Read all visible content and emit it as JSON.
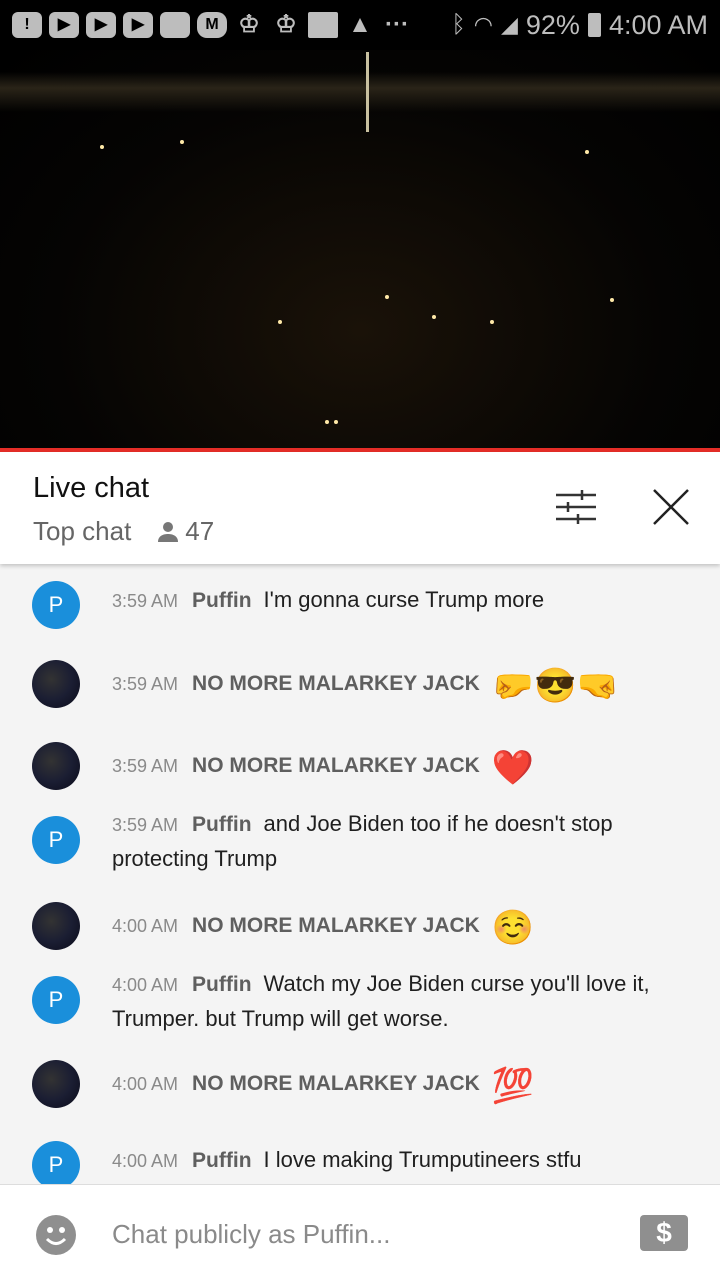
{
  "status_bar": {
    "battery": "92%",
    "time": "4:00 AM"
  },
  "video": {
    "progress_color": "#e52d27"
  },
  "chat_header": {
    "title": "Live chat",
    "mode": "Top chat",
    "viewer_count": "47"
  },
  "messages": [
    {
      "time": "3:59 AM",
      "author": "Puffin",
      "avatar_letter": "P",
      "text": "I'm gonna curse Trump more"
    },
    {
      "time": "3:59 AM",
      "author": "NO MORE MALARKEY JACK",
      "text": "🤛😎🤜"
    },
    {
      "time": "3:59 AM",
      "author": "NO MORE MALARKEY JACK",
      "text": "❤️"
    },
    {
      "time": "3:59 AM",
      "author": "Puffin",
      "avatar_letter": "P",
      "text": "and Joe Biden too if he doesn't stop protecting Trump"
    },
    {
      "time": "4:00 AM",
      "author": "NO MORE MALARKEY JACK",
      "text": "☺️"
    },
    {
      "time": "4:00 AM",
      "author": "Puffin",
      "avatar_letter": "P",
      "text": "Watch my Joe Biden curse you'll love it, Trumper. but Trump will get worse."
    },
    {
      "time": "4:00 AM",
      "author": "NO MORE MALARKEY JACK",
      "text": "💯"
    },
    {
      "time": "4:00 AM",
      "author": "Puffin",
      "avatar_letter": "P",
      "text": "I love making Trumputineers stfu"
    }
  ],
  "input": {
    "placeholder": "Chat publicly as Puffin...",
    "superchat_icon": "$"
  }
}
